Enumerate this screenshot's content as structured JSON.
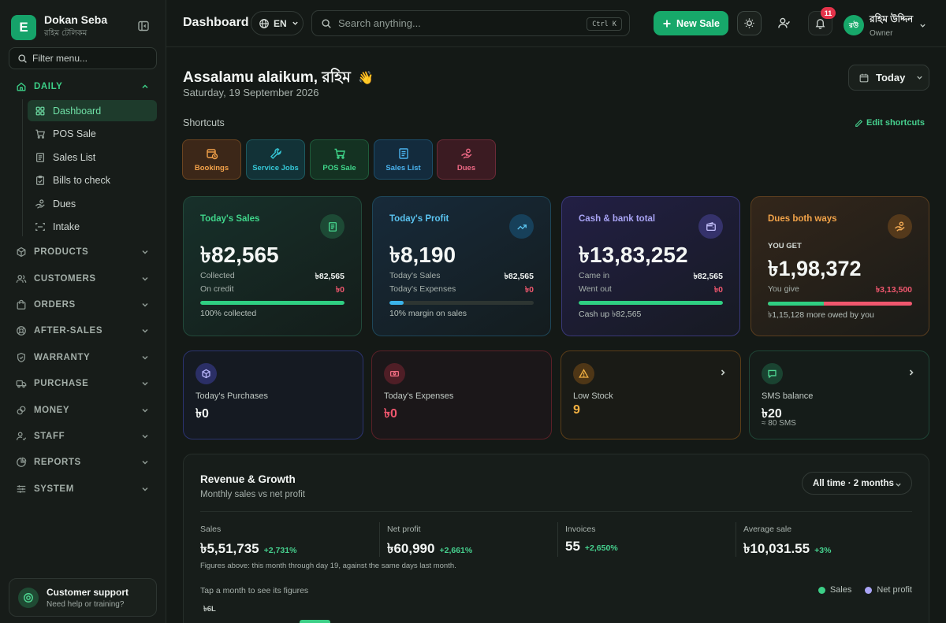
{
  "brand": {
    "name": "Dokan Seba",
    "subtitle": "রহিম টেলিকম",
    "logo_letter": "E"
  },
  "filter_placeholder": "Filter menu...",
  "sidebar": {
    "daily": {
      "label": "DAILY",
      "items": [
        {
          "label": "Dashboard",
          "icon": "grid-icon",
          "active": true
        },
        {
          "label": "POS Sale",
          "icon": "cart-icon"
        },
        {
          "label": "Sales List",
          "icon": "receipt-icon"
        },
        {
          "label": "Bills to check",
          "icon": "clipboard-icon"
        },
        {
          "label": "Dues",
          "icon": "hand-coins-icon"
        },
        {
          "label": "Intake",
          "icon": "scan-icon"
        }
      ]
    },
    "sections": [
      {
        "label": "PRODUCTS",
        "icon": "box-icon"
      },
      {
        "label": "CUSTOMERS",
        "icon": "users-icon"
      },
      {
        "label": "ORDERS",
        "icon": "bag-icon"
      },
      {
        "label": "AFTER-SALES",
        "icon": "lifebuoy-icon"
      },
      {
        "label": "WARRANTY",
        "icon": "shield-icon"
      },
      {
        "label": "PURCHASE",
        "icon": "truck-icon"
      },
      {
        "label": "MONEY",
        "icon": "wallet-icon"
      },
      {
        "label": "STAFF",
        "icon": "staff-icon"
      },
      {
        "label": "REPORTS",
        "icon": "pie-icon"
      },
      {
        "label": "SYSTEM",
        "icon": "sliders-icon"
      }
    ]
  },
  "support": {
    "title": "Customer support",
    "subtitle": "Need help or training?"
  },
  "topbar": {
    "title": "Dashboard",
    "lang": "EN",
    "search_placeholder": "Search anything...",
    "shortcut": "Ctrl K",
    "new_sale": "New Sale",
    "notifications": "11",
    "user_name": "রহিম উদ্দিন",
    "user_role": "Owner",
    "avatar_text": "রউ"
  },
  "greeting": {
    "text": "Assalamu alaikum, রহিম",
    "emoji": "👋",
    "date": "Saturday, 19 September 2026",
    "period": "Today"
  },
  "shortcuts": {
    "title": "Shortcuts",
    "edit": "Edit shortcuts",
    "items": [
      "Bookings",
      "Service Jobs",
      "POS Sale",
      "Sales List",
      "Dues"
    ]
  },
  "cards": {
    "sales": {
      "label": "Today's Sales",
      "value": "৳82,565",
      "r1l": "Collected",
      "r1v": "৳82,565",
      "r2l": "On credit",
      "r2v": "৳0",
      "progress": 1.0,
      "foot": "100% collected"
    },
    "profit": {
      "label": "Today's Profit",
      "value": "৳8,190",
      "r1l": "Today's Sales",
      "r1v": "৳82,565",
      "r2l": "Today's Expenses",
      "r2v": "৳0",
      "progress": 0.1,
      "foot": "10% margin on sales"
    },
    "cash": {
      "label": "Cash & bank total",
      "value": "৳13,83,252",
      "r1l": "Came in",
      "r1v": "৳82,565",
      "r2l": "Went out",
      "r2v": "৳0",
      "progress": 1.0,
      "foot": "Cash up ৳82,565"
    },
    "dues": {
      "label": "Dues both ways",
      "you_get": "YOU GET",
      "value": "৳1,98,372",
      "give_label": "You give",
      "give_value": "৳3,13,500",
      "get_share": 0.39,
      "foot": "৳1,15,128 more owed by you"
    }
  },
  "small_cards": [
    {
      "label": "Today's Purchases",
      "value": "৳0"
    },
    {
      "label": "Today's Expenses",
      "value": "৳0"
    },
    {
      "label": "Low Stock",
      "value": "9"
    },
    {
      "label": "SMS balance",
      "value": "৳20",
      "sub": "≈ 80 SMS"
    }
  ],
  "revenue": {
    "title": "Revenue & Growth",
    "subtitle": "Monthly sales vs net profit",
    "range": "All time · 2 months",
    "stats": [
      {
        "label": "Sales",
        "value": "৳5,51,735",
        "change": "+2,731%"
      },
      {
        "label": "Net profit",
        "value": "৳60,990",
        "change": "+2,661%"
      },
      {
        "label": "Invoices",
        "value": "55",
        "change": "+2,650%"
      },
      {
        "label": "Average sale",
        "value": "৳10,031.55",
        "change": "+3%"
      }
    ],
    "note": "Figures above: this month through day 19, against the same days last month.",
    "tap": "Tap a month to see its figures",
    "legend": [
      {
        "name": "Sales",
        "color": "#3ccf87"
      },
      {
        "name": "Net profit",
        "color": "#a9a4f5"
      }
    ],
    "ytick_top": "৳6L"
  }
}
